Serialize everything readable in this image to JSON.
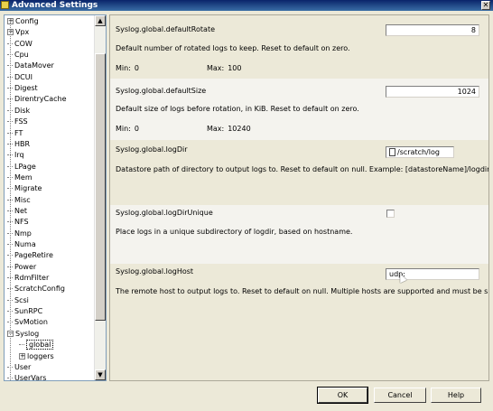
{
  "window": {
    "title": "Advanced Settings",
    "close_glyph": "✕"
  },
  "tree": {
    "items": [
      {
        "label": "Config",
        "expander": "+",
        "level": 0
      },
      {
        "label": "Vpx",
        "expander": "+",
        "level": 0
      },
      {
        "label": "COW",
        "level": 0
      },
      {
        "label": "Cpu",
        "level": 0
      },
      {
        "label": "DataMover",
        "level": 0
      },
      {
        "label": "DCUI",
        "level": 0
      },
      {
        "label": "Digest",
        "level": 0
      },
      {
        "label": "DirentryCache",
        "level": 0
      },
      {
        "label": "Disk",
        "level": 0
      },
      {
        "label": "FSS",
        "level": 0
      },
      {
        "label": "FT",
        "level": 0
      },
      {
        "label": "HBR",
        "level": 0
      },
      {
        "label": "Irq",
        "level": 0
      },
      {
        "label": "LPage",
        "level": 0
      },
      {
        "label": "Mem",
        "level": 0
      },
      {
        "label": "Migrate",
        "level": 0
      },
      {
        "label": "Misc",
        "level": 0
      },
      {
        "label": "Net",
        "level": 0
      },
      {
        "label": "NFS",
        "level": 0
      },
      {
        "label": "Nmp",
        "level": 0
      },
      {
        "label": "Numa",
        "level": 0
      },
      {
        "label": "PageRetire",
        "level": 0
      },
      {
        "label": "Power",
        "level": 0
      },
      {
        "label": "RdmFilter",
        "level": 0
      },
      {
        "label": "ScratchConfig",
        "level": 0
      },
      {
        "label": "Scsi",
        "level": 0
      },
      {
        "label": "SunRPC",
        "level": 0
      },
      {
        "label": "SvMotion",
        "level": 0
      },
      {
        "label": "Syslog",
        "expander": "−",
        "level": 0
      },
      {
        "label": "global",
        "level": 1,
        "selected": true
      },
      {
        "label": "loggers",
        "expander": "+",
        "level": 1
      },
      {
        "label": "User",
        "level": 0
      },
      {
        "label": "UserVars",
        "level": 0
      }
    ],
    "scroll_up_glyph": "▲",
    "scroll_down_glyph": "▼"
  },
  "settings": {
    "default_rotate": {
      "name": "Syslog.global.defaultRotate",
      "value": "8",
      "description": "Default number of rotated logs to keep. Reset to default on zero.",
      "min_label": "Min:",
      "min": "0",
      "max_label": "Max:",
      "max": "100"
    },
    "default_size": {
      "name": "Syslog.global.defaultSize",
      "value": "1024",
      "description": "Default size of logs before rotation, in KiB. Reset to default on zero.",
      "min_label": "Min:",
      "min": "0",
      "max_label": "Max:",
      "max": "10240"
    },
    "log_dir": {
      "name": "Syslog.global.logDir",
      "value": "/scratch/log",
      "description": "Datastore path of directory to output logs to. Reset to default on null. Example: [datastoreName]/logdir"
    },
    "log_dir_unique": {
      "name": "Syslog.global.logDirUnique",
      "checked": false,
      "description": "Place logs in a unique subdirectory of logdir, based on hostname."
    },
    "log_host": {
      "name": "Syslog.global.logHost",
      "value": "udp:",
      "description": "The remote host to output logs to. Reset to default on null. Multiple hosts are supported and must be s..."
    }
  },
  "buttons": {
    "ok": "OK",
    "cancel": "Cancel",
    "help": "Help"
  }
}
